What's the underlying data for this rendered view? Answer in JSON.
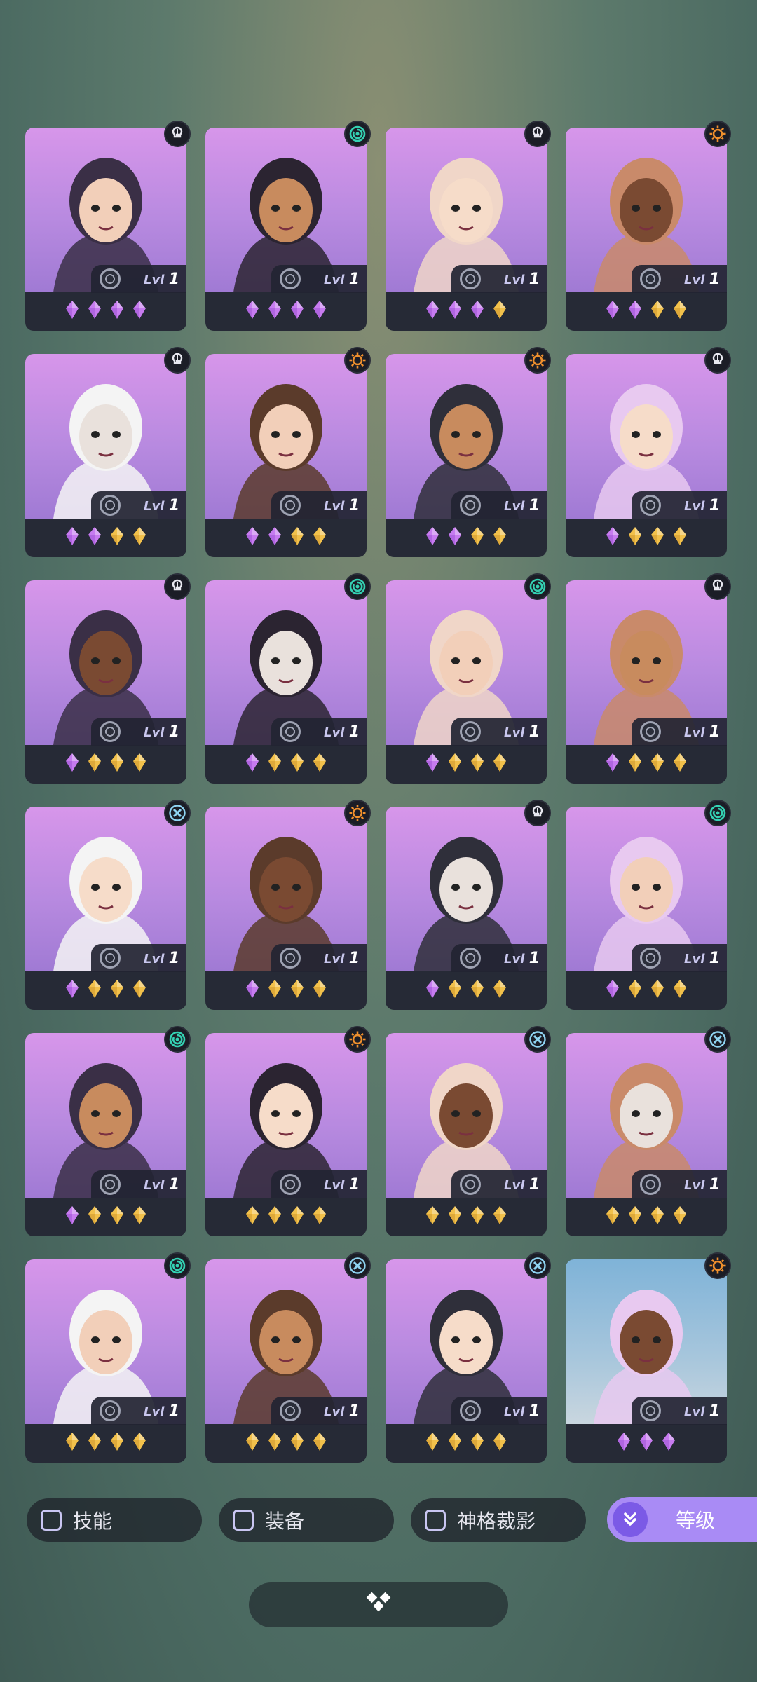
{
  "colors": {
    "gem_purple": "#c77bf0",
    "gem_gold": "#f2c14b",
    "class_mind": "#e8e8f0",
    "class_spiral": "#34d1b3",
    "class_sun": "#f0902d",
    "class_cross": "#8fd4f2",
    "accent": "#a98bf5"
  },
  "heroes": [
    {
      "class_icon": "mind-icon",
      "lvl": "1",
      "gems": [
        "purple",
        "purple",
        "purple",
        "purple"
      ],
      "bg": "purple"
    },
    {
      "class_icon": "spiral-icon",
      "lvl": "1",
      "gems": [
        "purple",
        "purple",
        "purple",
        "purple"
      ],
      "bg": "purple"
    },
    {
      "class_icon": "mind-icon",
      "lvl": "1",
      "gems": [
        "purple",
        "purple",
        "purple",
        "gold"
      ],
      "bg": "purple"
    },
    {
      "class_icon": "sun-icon",
      "lvl": "1",
      "gems": [
        "purple",
        "purple",
        "gold",
        "gold"
      ],
      "bg": "purple"
    },
    {
      "class_icon": "mind-icon",
      "lvl": "1",
      "gems": [
        "purple",
        "purple",
        "gold",
        "gold"
      ],
      "bg": "purple"
    },
    {
      "class_icon": "sun-icon",
      "lvl": "1",
      "gems": [
        "purple",
        "purple",
        "gold",
        "gold"
      ],
      "bg": "purple"
    },
    {
      "class_icon": "sun-icon",
      "lvl": "1",
      "gems": [
        "purple",
        "purple",
        "gold",
        "gold"
      ],
      "bg": "purple"
    },
    {
      "class_icon": "mind-icon",
      "lvl": "1",
      "gems": [
        "purple",
        "gold",
        "gold",
        "gold"
      ],
      "bg": "purple"
    },
    {
      "class_icon": "mind-icon",
      "lvl": "1",
      "gems": [
        "purple",
        "gold",
        "gold",
        "gold"
      ],
      "bg": "purple"
    },
    {
      "class_icon": "spiral-icon",
      "lvl": "1",
      "gems": [
        "purple",
        "gold",
        "gold",
        "gold"
      ],
      "bg": "purple"
    },
    {
      "class_icon": "spiral-icon",
      "lvl": "1",
      "gems": [
        "purple",
        "gold",
        "gold",
        "gold"
      ],
      "bg": "purple"
    },
    {
      "class_icon": "mind-icon",
      "lvl": "1",
      "gems": [
        "purple",
        "gold",
        "gold",
        "gold"
      ],
      "bg": "purple"
    },
    {
      "class_icon": "cross-icon",
      "lvl": "1",
      "gems": [
        "purple",
        "gold",
        "gold",
        "gold"
      ],
      "bg": "purple"
    },
    {
      "class_icon": "sun-icon",
      "lvl": "1",
      "gems": [
        "purple",
        "gold",
        "gold",
        "gold"
      ],
      "bg": "purple"
    },
    {
      "class_icon": "mind-icon",
      "lvl": "1",
      "gems": [
        "purple",
        "gold",
        "gold",
        "gold"
      ],
      "bg": "purple"
    },
    {
      "class_icon": "spiral-icon",
      "lvl": "1",
      "gems": [
        "purple",
        "gold",
        "gold",
        "gold"
      ],
      "bg": "purple"
    },
    {
      "class_icon": "spiral-icon",
      "lvl": "1",
      "gems": [
        "purple",
        "gold",
        "gold",
        "gold"
      ],
      "bg": "purple"
    },
    {
      "class_icon": "sun-icon",
      "lvl": "1",
      "gems": [
        "gold",
        "gold",
        "gold",
        "gold"
      ],
      "bg": "purple"
    },
    {
      "class_icon": "cross-icon",
      "lvl": "1",
      "gems": [
        "gold",
        "gold",
        "gold",
        "gold"
      ],
      "bg": "purple"
    },
    {
      "class_icon": "cross-icon",
      "lvl": "1",
      "gems": [
        "gold",
        "gold",
        "gold",
        "gold"
      ],
      "bg": "purple"
    },
    {
      "class_icon": "spiral-icon",
      "lvl": "1",
      "gems": [
        "gold",
        "gold",
        "gold",
        "gold"
      ],
      "bg": "purple"
    },
    {
      "class_icon": "cross-icon",
      "lvl": "1",
      "gems": [
        "gold",
        "gold",
        "gold",
        "gold"
      ],
      "bg": "purple"
    },
    {
      "class_icon": "cross-icon",
      "lvl": "1",
      "gems": [
        "gold",
        "gold",
        "gold",
        "gold"
      ],
      "bg": "purple"
    },
    {
      "class_icon": "sun-icon",
      "lvl": "1",
      "gems": [
        "purple",
        "purple",
        "purple"
      ],
      "bg": "blue"
    }
  ],
  "lvl_prefix": "Lvl",
  "filters": [
    {
      "label": "技能"
    },
    {
      "label": "装备"
    },
    {
      "label": "神格裁影"
    }
  ],
  "sort_button": {
    "label": "等级",
    "icon": "double-chevron-down-icon"
  },
  "bottom_bar": {
    "icon": "diamond-cluster-icon"
  }
}
